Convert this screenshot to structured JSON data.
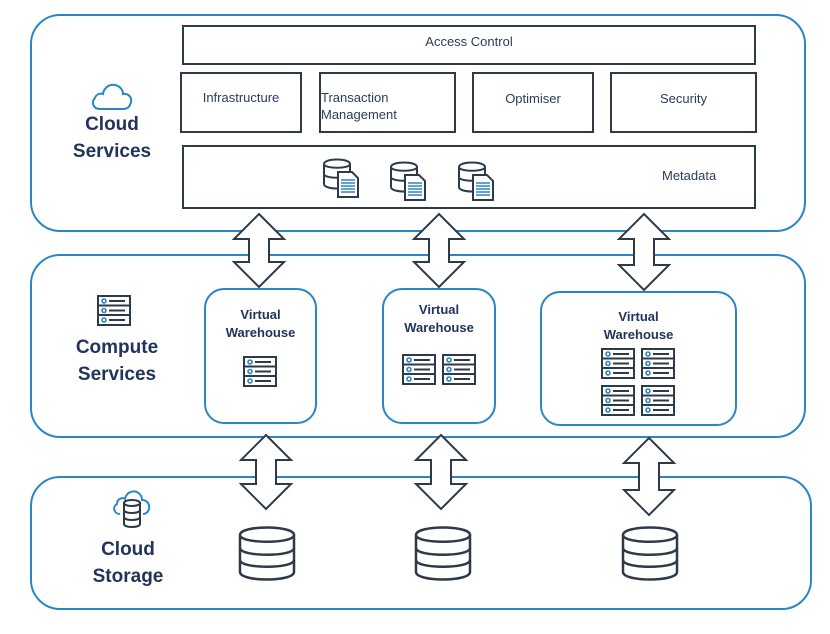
{
  "diagram": {
    "layers": {
      "cloud_services": {
        "label_line1": "Cloud",
        "label_line2": "Services",
        "icon": "cloud-icon",
        "boxes": {
          "access_control": "Access Control",
          "infrastructure": "Infrastructure",
          "transaction_management_line1": "Transaction",
          "transaction_management_line2": "Management",
          "optimiser": "Optimiser",
          "security": "Security",
          "metadata": "Metadata"
        },
        "metadata_icons": [
          "database-document-icon",
          "database-document-icon",
          "database-document-icon"
        ]
      },
      "compute_services": {
        "label_line1": "Compute",
        "label_line2": "Services",
        "icon": "server-icon",
        "warehouses": [
          {
            "title_line1": "Virtual",
            "title_line2": "Warehouse",
            "servers": 1
          },
          {
            "title_line1": "Virtual",
            "title_line2": "Warehouse",
            "servers": 2
          },
          {
            "title_line1": "Virtual",
            "title_line2": "Warehouse",
            "servers": 4
          }
        ]
      },
      "cloud_storage": {
        "label_line1": "Cloud",
        "label_line2": "Storage",
        "icon": "cloud-database-icon",
        "databases": [
          "database-icon",
          "database-icon",
          "database-icon"
        ]
      }
    },
    "connectors": "double-arrow",
    "colors": {
      "layer_border": "#2a86c5",
      "box_border": "#2f3a48",
      "label_text": "#22335c",
      "icon_accent": "#2a86c5"
    }
  }
}
